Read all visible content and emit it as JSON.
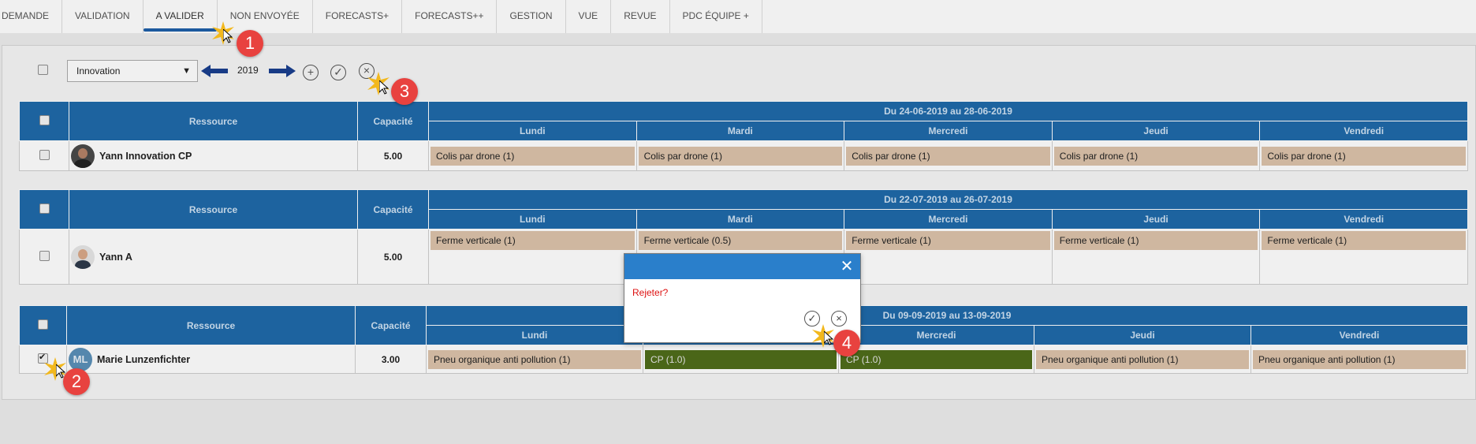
{
  "tabs": [
    "DEMANDE",
    "VALIDATION",
    "A VALIDER",
    "NON ENVOYÉE",
    "FORECASTS+",
    "FORECASTS++",
    "GESTION",
    "VUE",
    "REVUE",
    "PDC ÉQUIPE +"
  ],
  "active_tab_index": 2,
  "toolbar": {
    "project_select_value": "Innovation",
    "year": "2019",
    "icons": [
      "arrow-left-icon",
      "arrow-right-icon",
      "add-circle-icon",
      "check-circle-icon",
      "close-circle-icon"
    ]
  },
  "grid_headers": {
    "ressource": "Ressource",
    "capacite": "Capacité"
  },
  "days": [
    "Lundi",
    "Mardi",
    "Mercredi",
    "Jeudi",
    "Vendredi"
  ],
  "blocks": [
    {
      "period": "Du 24-06-2019 au 28-06-2019",
      "resource": "Yann Innovation CP",
      "capacity": "5.00",
      "checked": false,
      "cells": [
        "Colis par drone (1)",
        "Colis par drone (1)",
        "Colis par drone (1)",
        "Colis par drone (1)",
        "Colis par drone (1)"
      ]
    },
    {
      "period": "Du 22-07-2019 au 26-07-2019",
      "resource": "Yann A",
      "capacity": "5.00",
      "checked": false,
      "cells": [
        "Ferme verticale (1)",
        "Ferme verticale (0.5)",
        "Ferme verticale (1)",
        "Ferme verticale (1)",
        "Ferme verticale (1)"
      ]
    },
    {
      "period": "Du 09-09-2019 au 13-09-2019",
      "resource": "Marie Lunzenfichter",
      "avatar_initials": "ML",
      "capacity": "3.00",
      "checked": true,
      "cells": [
        "Pneu organique anti pollution (1)",
        "CP (1.0)",
        "CP (1.0)",
        "Pneu organique anti pollution (1)",
        "Pneu organique anti pollution (1)"
      ]
    }
  ],
  "dialog": {
    "message": "Rejeter?"
  },
  "markers": [
    "1",
    "2",
    "3",
    "4"
  ],
  "colors": {
    "header_blue": "#1f6aa9",
    "task_tan": "#dcc3aa",
    "task_green": "#4f6d1a",
    "dialog_header": "#2a7fcb",
    "marker_red": "#e8423f",
    "message_red": "#dd1111"
  }
}
